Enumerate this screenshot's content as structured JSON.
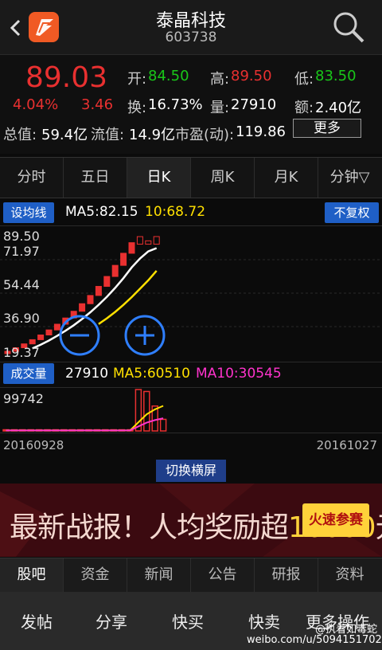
{
  "header": {
    "back_icon": "chevron-left-icon",
    "app_icon": "app-logo-icon",
    "title": "泰晶科技",
    "code": "603738",
    "search_icon": "search-icon"
  },
  "quote": {
    "price": "89.03",
    "change_pct": "4.04%",
    "change": "3.46",
    "open_label": "开:",
    "open": "84.50",
    "high_label": "高:",
    "high": "89.50",
    "low_label": "低:",
    "low": "83.50",
    "turnover_label": "换:",
    "turnover": "16.73%",
    "volume_label": "量:",
    "volume": "27910",
    "amount_label": "额:",
    "amount": "2.40亿",
    "mktcap_label": "总值:",
    "mktcap": "59.4亿",
    "float_label": "流值:",
    "float_value": "14.9亿",
    "pe_label": "市盈(动):",
    "pe": "119.86",
    "more_button": "更多",
    "colors": {
      "up": "#e93030",
      "down": "#19c719"
    }
  },
  "tabs": [
    {
      "label": "分时",
      "active": false
    },
    {
      "label": "五日",
      "active": false
    },
    {
      "label": "日K",
      "active": true
    },
    {
      "label": "周K",
      "active": false
    },
    {
      "label": "月K",
      "active": false
    },
    {
      "label": "分钟▽",
      "active": false
    }
  ],
  "kline": {
    "set_ma_button": "设均线",
    "ma5": "MA5:82.15",
    "ma10": "10:68.72",
    "adjust_button": "不复权",
    "zoom_out_icon": "minus-circle-icon",
    "zoom_in_icon": "plus-circle-icon"
  },
  "volume": {
    "label_button": "成交量",
    "value": "27910",
    "ma5": "MA5:60510",
    "ma10": "MA10:30545"
  },
  "chart_data": [
    {
      "type": "candlestick",
      "y_ticks": [
        "89.50",
        "71.97",
        "54.44",
        "36.90",
        "19.37"
      ],
      "ylim": [
        19.37,
        89.5
      ],
      "x_range": [
        "20160928",
        "20161027"
      ],
      "candles": [
        {
          "o": 19.4,
          "c": 20.8
        },
        {
          "o": 20.8,
          "c": 22.9
        },
        {
          "o": 22.9,
          "c": 25.2
        },
        {
          "o": 25.2,
          "c": 27.7
        },
        {
          "o": 27.7,
          "c": 30.5
        },
        {
          "o": 30.5,
          "c": 33.5
        },
        {
          "o": 33.5,
          "c": 36.9
        },
        {
          "o": 36.9,
          "c": 40.6
        },
        {
          "o": 40.6,
          "c": 44.6
        },
        {
          "o": 44.6,
          "c": 49.1
        },
        {
          "o": 49.1,
          "c": 54.0
        },
        {
          "o": 54.0,
          "c": 59.4
        },
        {
          "o": 59.4,
          "c": 65.3
        },
        {
          "o": 65.3,
          "c": 71.9
        },
        {
          "o": 71.9,
          "c": 79.1
        },
        {
          "o": 79.1,
          "c": 85.4
        },
        {
          "o": 84.5,
          "c": 89.0
        },
        {
          "o": 84.5,
          "c": 86.5
        },
        {
          "o": 84.5,
          "c": 89.03
        }
      ],
      "ma5": [
        22.5,
        24.7,
        27.2,
        30.0,
        33.0,
        36.3,
        40.0,
        44.0,
        48.4,
        53.2,
        58.5,
        64.3,
        70.7,
        76.0,
        80.2,
        82.15
      ],
      "ma10": [
        37.0,
        40.4,
        44.2,
        48.4,
        53.0,
        58.0,
        63.0,
        68.72
      ],
      "colors": {
        "candle": "#e93030",
        "ma5": "#ffffff",
        "ma10": "#ffe000"
      }
    },
    {
      "type": "bar",
      "y_ticks": [
        "99742"
      ],
      "ylim": [
        0,
        99742
      ],
      "values": [
        1200,
        1200,
        1200,
        1200,
        1200,
        1200,
        1200,
        1200,
        1200,
        1200,
        1200,
        1200,
        1200,
        1200,
        1200,
        1500,
        99742,
        95000,
        60000,
        27910
      ],
      "ma5": [
        1200,
        1200,
        1200,
        1200,
        1200,
        1200,
        1200,
        1200,
        1200,
        1200,
        1200,
        1200,
        1200,
        1200,
        1200,
        1300,
        21000,
        40000,
        52000,
        60510
      ],
      "ma10": [
        1200,
        1200,
        1200,
        1200,
        1200,
        1200,
        1200,
        1200,
        1200,
        1200,
        1200,
        1200,
        1200,
        1200,
        1200,
        1250,
        11000,
        20000,
        26000,
        30545
      ],
      "colors": {
        "bar": "#e93030",
        "ma5": "#ffe000",
        "ma10": "#ff33cc"
      }
    }
  ],
  "dates": {
    "start": "20160928",
    "end": "20161027"
  },
  "landscape_button": "切换横屏",
  "banner": {
    "text_a": "最新战报！人均奖励超",
    "text_b": "10000",
    "text_c": "元!",
    "button": "火速参赛"
  },
  "bottom_tabs": [
    {
      "label": "股吧",
      "active": true
    },
    {
      "label": "资金",
      "active": false
    },
    {
      "label": "新闻",
      "active": false
    },
    {
      "label": "公告",
      "active": false
    },
    {
      "label": "研报",
      "active": false
    },
    {
      "label": "资料",
      "active": false
    }
  ],
  "actions": [
    "发帖",
    "分享",
    "快买",
    "快卖",
    "更多操作"
  ],
  "watermark": {
    "handle": "@执着如毒蛇",
    "url": "weibo.com/u/5094151702"
  }
}
